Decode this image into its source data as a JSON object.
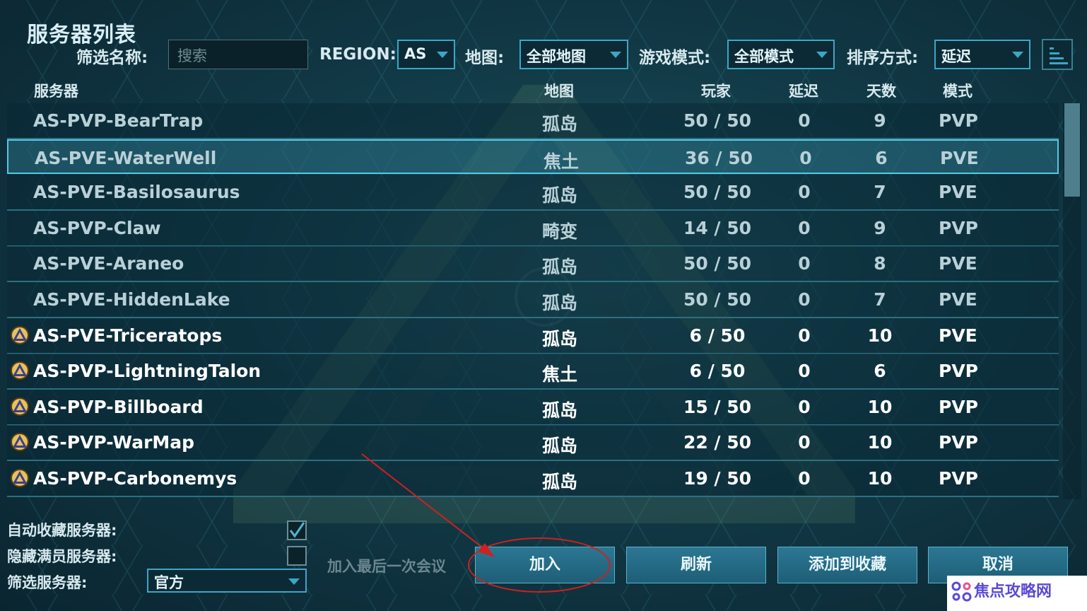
{
  "title": "服务器列表",
  "filters": {
    "name_label": "筛选名称:",
    "search_placeholder": "搜索",
    "region_label": "REGION:",
    "region_value": "AS",
    "map_label": "地图:",
    "map_value": "全部地图",
    "mode_label": "游戏模式:",
    "mode_value": "全部模式",
    "sort_label": "排序方式:",
    "sort_value": "延迟"
  },
  "columns": {
    "server": "服务器",
    "map": "地图",
    "players": "玩家",
    "ping": "延迟",
    "days": "天数",
    "mode": "模式"
  },
  "servers": [
    {
      "name": "AS-PVP-BearTrap",
      "map": "孤岛",
      "players": "50 / 50",
      "ping": "0",
      "days": "9",
      "mode": "PVP",
      "favorite": false,
      "selected": false
    },
    {
      "name": "AS-PVE-WaterWell",
      "map": "焦土",
      "players": "36 / 50",
      "ping": "0",
      "days": "6",
      "mode": "PVE",
      "favorite": false,
      "selected": true
    },
    {
      "name": "AS-PVE-Basilosaurus",
      "map": "孤岛",
      "players": "50 / 50",
      "ping": "0",
      "days": "7",
      "mode": "PVE",
      "favorite": false,
      "selected": false
    },
    {
      "name": "AS-PVP-Claw",
      "map": "畸变",
      "players": "14 / 50",
      "ping": "0",
      "days": "9",
      "mode": "PVP",
      "favorite": false,
      "selected": false
    },
    {
      "name": "AS-PVE-Araneo",
      "map": "孤岛",
      "players": "50 / 50",
      "ping": "0",
      "days": "8",
      "mode": "PVE",
      "favorite": false,
      "selected": false
    },
    {
      "name": "AS-PVE-HiddenLake",
      "map": "孤岛",
      "players": "50 / 50",
      "ping": "0",
      "days": "7",
      "mode": "PVE",
      "favorite": false,
      "selected": false
    },
    {
      "name": "AS-PVE-Triceratops",
      "map": "孤岛",
      "players": "6 / 50",
      "ping": "0",
      "days": "10",
      "mode": "PVE",
      "favorite": true,
      "selected": false
    },
    {
      "name": "AS-PVP-LightningTalon",
      "map": "焦土",
      "players": "6 / 50",
      "ping": "0",
      "days": "6",
      "mode": "PVP",
      "favorite": true,
      "selected": false
    },
    {
      "name": "AS-PVP-Billboard",
      "map": "孤岛",
      "players": "15 / 50",
      "ping": "0",
      "days": "10",
      "mode": "PVP",
      "favorite": true,
      "selected": false
    },
    {
      "name": "AS-PVP-WarMap",
      "map": "孤岛",
      "players": "22 / 50",
      "ping": "0",
      "days": "10",
      "mode": "PVP",
      "favorite": true,
      "selected": false
    },
    {
      "name": "AS-PVP-Carbonemys",
      "map": "孤岛",
      "players": "19 / 50",
      "ping": "0",
      "days": "10",
      "mode": "PVP",
      "favorite": true,
      "selected": false
    }
  ],
  "options": {
    "auto_favorite_label": "自动收藏服务器:",
    "auto_favorite_checked": true,
    "hide_full_label": "隐藏满员服务器:",
    "hide_full_checked": false,
    "filter_server_label": "筛选服务器:",
    "filter_server_value": "官方"
  },
  "join_last_session": "加入最后一次会议",
  "buttons": {
    "join": "加入",
    "refresh": "刷新",
    "add_favorite": "添加到收藏",
    "cancel": "取消"
  },
  "watermark": "焦点攻略网",
  "colors": {
    "accent": "#3aa7c7",
    "annotation_red": "#d0201f",
    "watermark_purple": "#5a4bd6"
  }
}
